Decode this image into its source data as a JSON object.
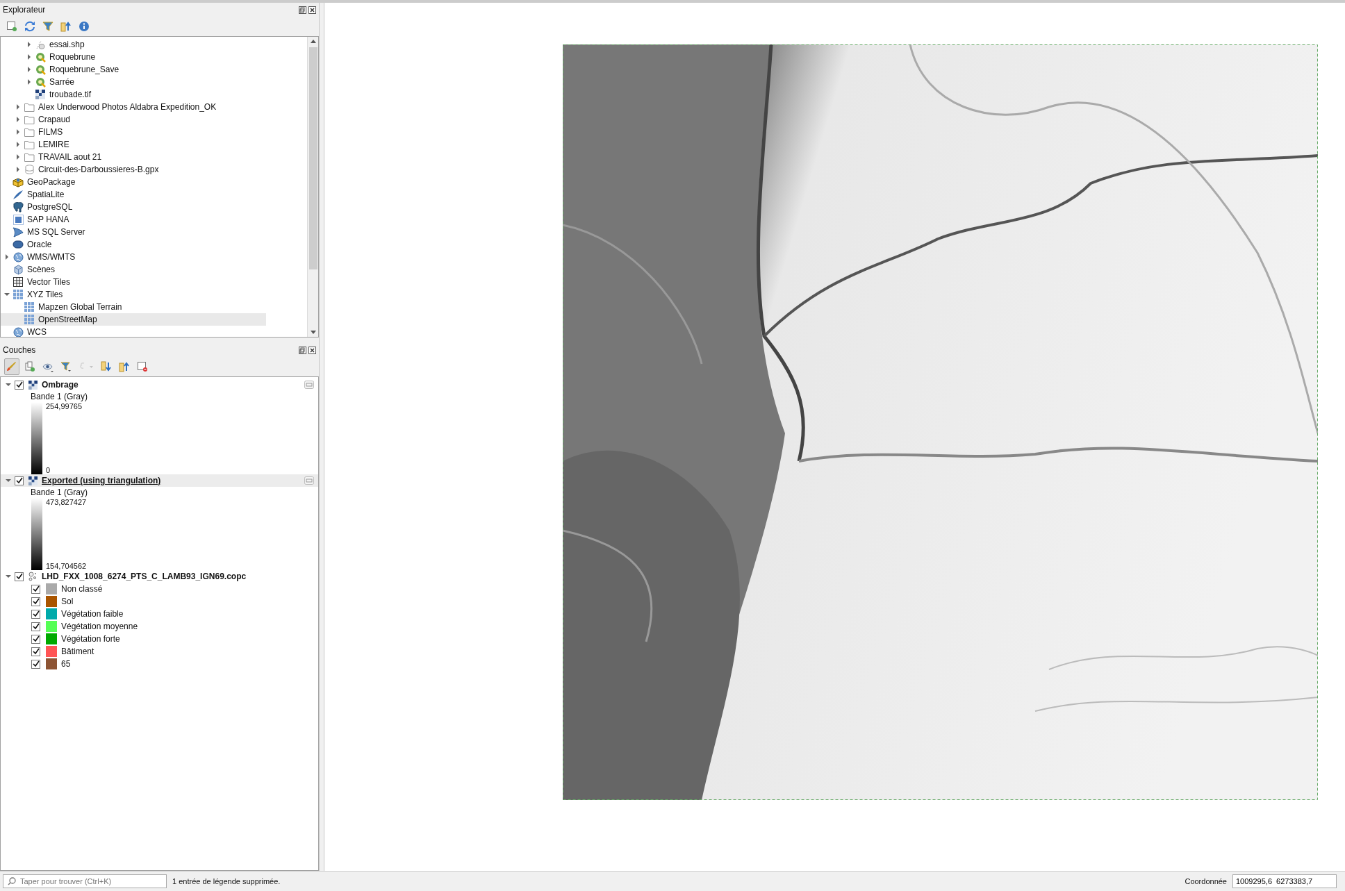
{
  "explorer": {
    "title": "Explorateur",
    "toolbar": [
      {
        "kind": "add"
      },
      {
        "kind": "refresh"
      },
      {
        "kind": "filter"
      },
      {
        "kind": "collapse"
      },
      {
        "kind": "info"
      }
    ],
    "tree": [
      {
        "children": [
          {
            "children": [
              {
                "label": "essai.shp",
                "kind": "shapefile",
                "expanded": false,
                "selected": false
              },
              {
                "label": "Roquebrune",
                "kind": "project",
                "expanded": false,
                "selected": false
              },
              {
                "label": "Roquebrune_Save",
                "kind": "project",
                "expanded": false,
                "selected": false
              },
              {
                "label": "Sarrée",
                "kind": "project",
                "expanded": false,
                "selected": false
              },
              {
                "label": "troubade.tif",
                "kind": "raster",
                "selected": false
              }
            ]
          },
          {
            "label": "Alex Underwood Photos Aldabra Expedition_OK",
            "kind": "folder",
            "expanded": false,
            "selected": false
          },
          {
            "label": "Crapaud",
            "kind": "folder",
            "expanded": false,
            "selected": false
          },
          {
            "label": "FILMS",
            "kind": "folder",
            "expanded": false,
            "selected": false
          },
          {
            "label": "LEMIRE",
            "kind": "folder",
            "expanded": false,
            "selected": false
          },
          {
            "label": "TRAVAIL aout 21",
            "kind": "folder",
            "expanded": false,
            "selected": false
          },
          {
            "label": "Circuit-des-Darboussieres-B.gpx",
            "kind": "gpx",
            "expanded": false,
            "selected": false
          }
        ]
      },
      {
        "label": "GeoPackage",
        "kind": "geopackage",
        "selected": false
      },
      {
        "label": "SpatiaLite",
        "kind": "spatialite",
        "selected": false
      },
      {
        "label": "PostgreSQL",
        "kind": "postgres",
        "selected": false
      },
      {
        "label": "SAP HANA",
        "kind": "saphana",
        "selected": false
      },
      {
        "label": "MS SQL Server",
        "kind": "mssql",
        "selected": false
      },
      {
        "label": "Oracle",
        "kind": "oracle",
        "selected": false
      },
      {
        "label": "WMS/WMTS",
        "kind": "globe",
        "expanded": false,
        "selected": false
      },
      {
        "label": "Scènes",
        "kind": "scenes",
        "selected": false
      },
      {
        "label": "Vector Tiles",
        "kind": "grid",
        "selected": false
      },
      {
        "label": "XYZ Tiles",
        "kind": "tiles",
        "expanded": true,
        "selected": false,
        "children": [
          {
            "label": "Mapzen Global Terrain",
            "kind": "tiles",
            "selected": false
          },
          {
            "label": "OpenStreetMap",
            "kind": "tiles",
            "selected": true
          }
        ]
      },
      {
        "label": "WCS",
        "kind": "globe",
        "selected": false
      }
    ]
  },
  "layers": {
    "title": "Couches",
    "toolbar": [
      {
        "kind": "style",
        "pressed": true,
        "disabled": false
      },
      {
        "kind": "add-group",
        "pressed": false,
        "disabled": false
      },
      {
        "kind": "visibility",
        "pressed": false,
        "disabled": false
      },
      {
        "kind": "filter",
        "pressed": false,
        "disabled": false
      },
      {
        "kind": "expression",
        "pressed": false,
        "disabled": true
      },
      {
        "kind": "expand",
        "pressed": false,
        "disabled": false
      },
      {
        "kind": "collapse",
        "pressed": false,
        "disabled": false
      },
      {
        "kind": "remove",
        "pressed": false,
        "disabled": false
      }
    ],
    "items": [
      {
        "name": "Ombrage",
        "kind": "raster",
        "checked": true,
        "expanded": true,
        "selected": false,
        "band": "Bande 1 (Gray)",
        "max": "254,99765",
        "min": "0"
      },
      {
        "name": "Exported (using triangulation)",
        "kind": "raster",
        "checked": true,
        "expanded": true,
        "selected": true,
        "band": "Bande 1 (Gray)",
        "max": "473,827427",
        "min": "154,704562"
      },
      {
        "name": "LHD_FXX_1008_6274_PTS_C_LAMB93_IGN69.copc",
        "kind": "pointcloud",
        "checked": true,
        "expanded": true,
        "selected": false,
        "classes": [
          {
            "label": "Non classé",
            "color": "#aaaaaa",
            "checked": true
          },
          {
            "label": "Sol",
            "color": "#aa5500",
            "checked": true
          },
          {
            "label": "Végétation faible",
            "color": "#00aaaa",
            "checked": true
          },
          {
            "label": "Végétation moyenne",
            "color": "#55ff55",
            "checked": true
          },
          {
            "label": "Végétation forte",
            "color": "#00aa00",
            "checked": true
          },
          {
            "label": "Bâtiment",
            "color": "#ff5555",
            "checked": true
          },
          {
            "label": "65",
            "color": "#8d5434",
            "checked": true
          }
        ]
      }
    ]
  },
  "status_bar": {
    "search_placeholder": "Taper pour trouver (Ctrl+K)",
    "message": "1 entrée de légende supprimée.",
    "coordinate_label": "Coordonnée",
    "coordinate_value": "1009295,6  6273383,7"
  }
}
